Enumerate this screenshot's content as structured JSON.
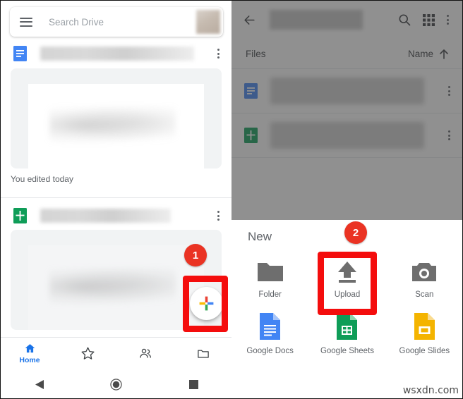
{
  "left_screen": {
    "search": {
      "placeholder": "Search Drive",
      "menu_icon": "hamburger-menu-icon",
      "avatar_icon": "account-avatar"
    },
    "file_rows": [
      {
        "icon": "google-docs-icon",
        "name": "",
        "overflow_icon": "more-vert-icon"
      },
      {
        "icon": "google-sheets-icon",
        "name": "",
        "overflow_icon": "more-vert-icon"
      }
    ],
    "edited_label": "You edited today",
    "fab": {
      "icon": "google-plus-icon",
      "label": ""
    },
    "bottom_nav": [
      {
        "icon": "home-icon",
        "label": "Home",
        "active": true
      },
      {
        "icon": "star-icon",
        "label": "",
        "active": false
      },
      {
        "icon": "shared-people-icon",
        "label": "",
        "active": false
      },
      {
        "icon": "folder-icon",
        "label": "",
        "active": false
      }
    ],
    "android_nav": [
      {
        "icon": "back-triangle-icon"
      },
      {
        "icon": "home-circle-icon"
      },
      {
        "icon": "recents-square-icon"
      }
    ]
  },
  "right_screen": {
    "appbar": {
      "back_icon": "back-arrow-icon",
      "title": "",
      "search_icon": "search-icon",
      "grid_icon": "grid-view-icon",
      "overflow_icon": "more-vert-icon"
    },
    "subbar": {
      "files_label": "Files",
      "sort_label": "Name",
      "sort_icon": "arrow-up-icon"
    },
    "file_rows": [
      {
        "icon": "google-docs-icon",
        "name": "",
        "overflow_icon": "more-vert-icon"
      },
      {
        "icon": "google-sheets-icon",
        "name": "",
        "overflow_icon": "more-vert-icon"
      }
    ],
    "sheet": {
      "title": "New",
      "rows": [
        [
          {
            "icon": "folder-icon",
            "label": "Folder"
          },
          {
            "icon": "upload-icon",
            "label": "Upload"
          },
          {
            "icon": "camera-scan-icon",
            "label": "Scan"
          }
        ],
        [
          {
            "icon": "google-docs-icon",
            "label": "Google Docs"
          },
          {
            "icon": "google-sheets-icon",
            "label": "Google Sheets"
          },
          {
            "icon": "google-slides-icon",
            "label": "Google Slides"
          }
        ]
      ]
    }
  },
  "annotations": [
    {
      "badge": "1",
      "target": "fab-new-button"
    },
    {
      "badge": "2",
      "target": "upload-option"
    }
  ],
  "watermark": "wsxdn.com",
  "colors": {
    "annotation_red": "#f40d0d",
    "badge_red": "#ea3323",
    "docs_blue": "#4285f4",
    "sheets_green": "#0f9d58",
    "slides_yellow": "#f4b400",
    "nav_active_blue": "#1a73e8",
    "icon_gray": "#5f6368",
    "overlay_gray": "#6e6e6e"
  }
}
